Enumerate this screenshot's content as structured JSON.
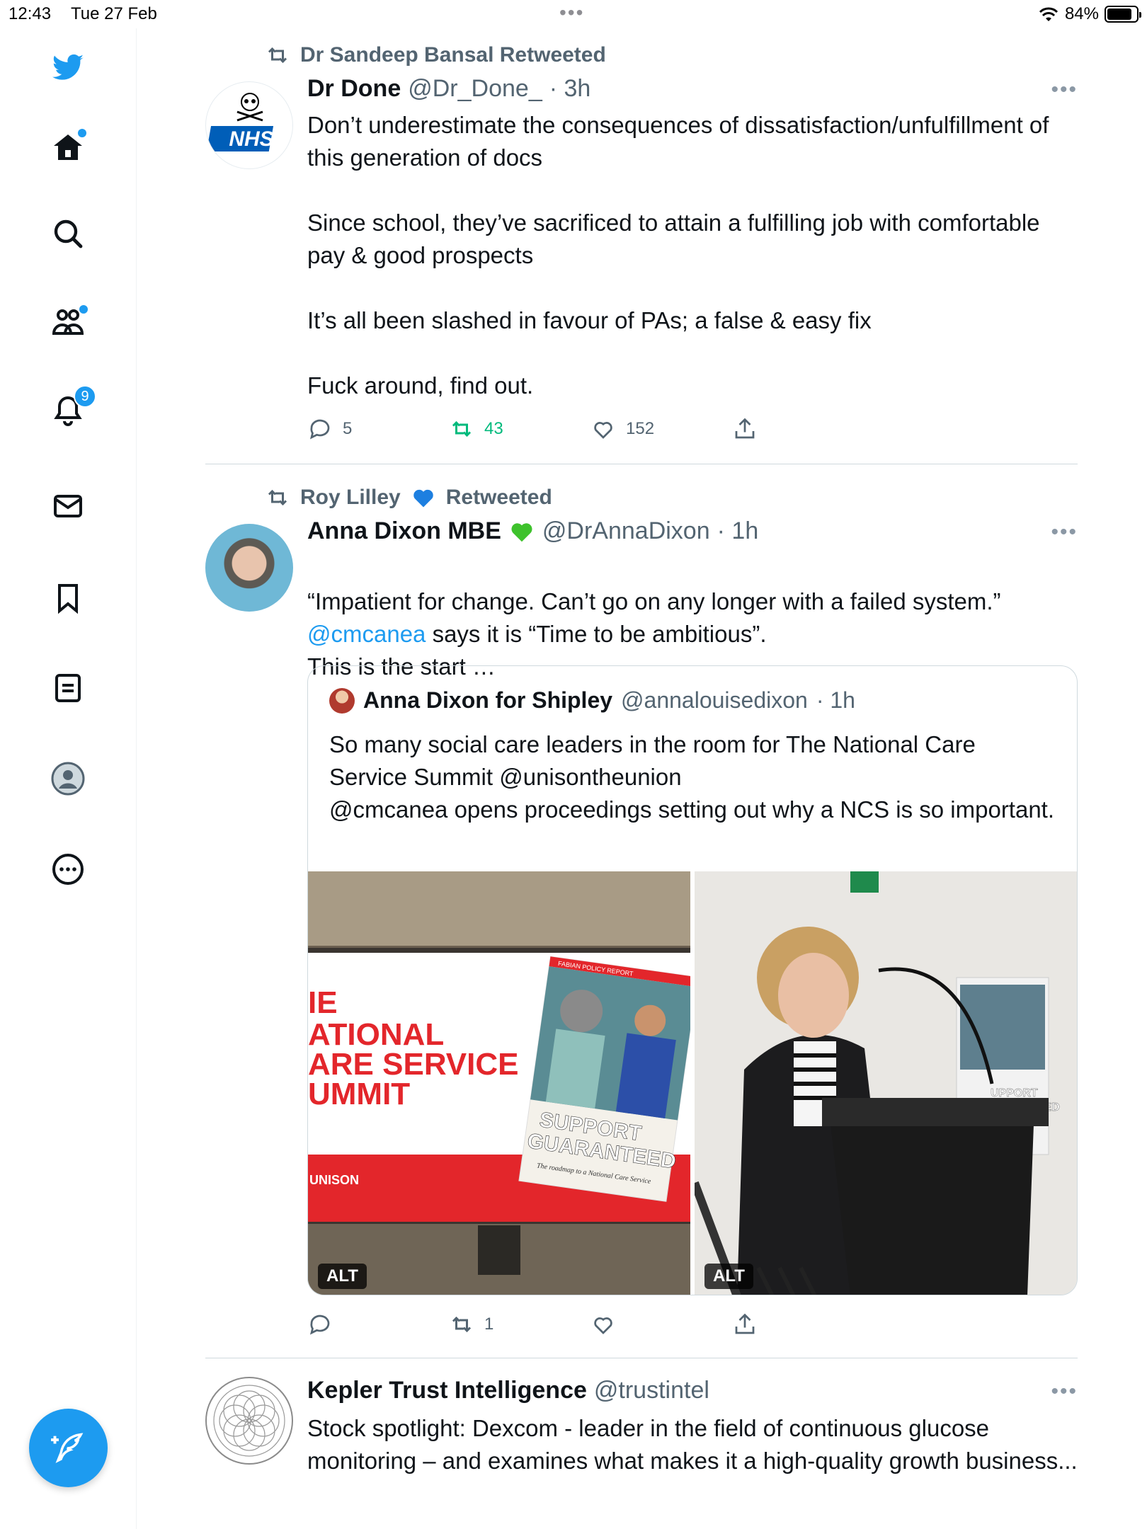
{
  "status": {
    "time": "12:43",
    "date": "Tue 27 Feb",
    "battery": "84%",
    "battery_level": 0.84
  },
  "sidebar": {
    "items": [
      {
        "name": "twitter-logo"
      },
      {
        "name": "home"
      },
      {
        "name": "explore"
      },
      {
        "name": "communities"
      },
      {
        "name": "notifications",
        "badge": "9"
      },
      {
        "name": "messages"
      },
      {
        "name": "bookmarks"
      },
      {
        "name": "lists"
      },
      {
        "name": "profile"
      },
      {
        "name": "more"
      }
    ],
    "accent": "#1d9bf0"
  },
  "tweets": [
    {
      "social": "Dr Sandeep Bansal Retweeted",
      "name": "Dr Done",
      "handle": "@Dr_Done_",
      "time": "· 3h",
      "text": "Don’t underestimate the consequences of dissatisfaction/unfulfillment of this generation of docs\n\nSince school, they’ve sacrificed to attain a fulfilling job with comfortable pay & good prospects\n\nIt’s all been slashed in favour of PAs; a false & easy fix\n\nFuck around, find out.",
      "avatar_text": "NHS",
      "replies": "5",
      "retweets": "43",
      "likes": "152"
    },
    {
      "social_name": "Roy Lilley",
      "social_suffix": "Retweeted",
      "name": "Anna Dixon MBE",
      "handle": "@DrAnnaDixon",
      "time": "· 1h",
      "text_line1": "“Impatient for change. Can’t go on any longer with a failed system.”",
      "text_mention": "@cmcanea",
      "text_line2": " says it is “Time to be ambitious”.",
      "text_line3": "This is the start …",
      "quote": {
        "name": "Anna Dixon for Shipley",
        "handle": "@annalouisedixon",
        "time": "· 1h",
        "text": "So many social care leaders in the room for The National Care Service Summit @unisontheunion\n@cmcanea opens proceedings setting out why a NCS is so important.",
        "image1": {
          "screen_text": "IE\nATIONAL\nARE SERVICE\nUMMIT",
          "cover_small": "FABIAN POLICY REPORT",
          "cover_title": "SUPPORT\nGUARANTEED",
          "cover_sub": "The roadmap to a National Care Service",
          "unison": "UNISON"
        },
        "image2": {
          "sign_text": "UPPORT\nJARANTEED"
        },
        "alt_label": "ALT"
      },
      "retweets": "1"
    },
    {
      "name": "Kepler Trust Intelligence",
      "handle": "@trustintel",
      "text": "Stock spotlight: Dexcom - leader in the field of continuous glucose monitoring – and examines what makes it a high-quality growth business..."
    }
  ]
}
